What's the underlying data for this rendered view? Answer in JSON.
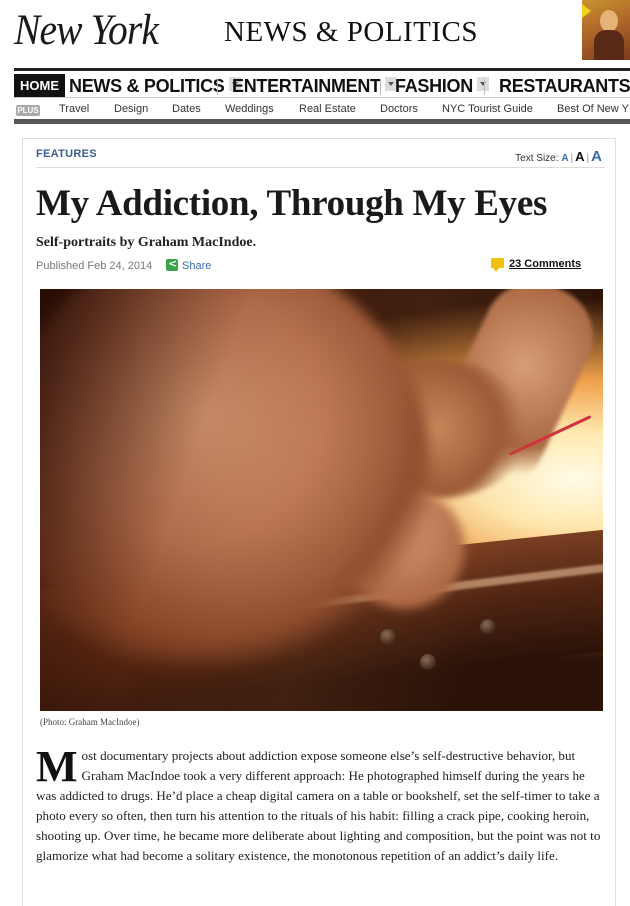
{
  "masthead": {
    "logo": "New York",
    "section": "NEWS & POLITICS"
  },
  "nav": {
    "home": "HOME",
    "items": [
      {
        "label": "NEWS & POLITICS"
      },
      {
        "label": "ENTERTAINMENT"
      },
      {
        "label": "FASHION"
      },
      {
        "label": "RESTAURANTS"
      }
    ]
  },
  "subnav": {
    "plus": "PLUS",
    "items": [
      "Travel",
      "Design",
      "Dates",
      "Weddings",
      "Real Estate",
      "Doctors",
      "NYC Tourist Guide",
      "Best Of New Y"
    ]
  },
  "article": {
    "section": "FEATURES",
    "text_size_label": "Text Size:",
    "text_size_options": [
      "A",
      "A",
      "A"
    ],
    "headline": "My Addiction, Through My Eyes",
    "dek": "Self-portraits by Graham MacIndoe.",
    "published": "Published Feb 24, 2014",
    "share": "Share",
    "comments": "23 Comments",
    "caption": "(Photo: Graham MacIndoe)",
    "dropcap": "M",
    "body": "ost documentary projects about addiction expose someone else’s self-destructive behavior, but Graham MacIndoe took a very different approach: He photographed himself during the years he was addicted to drugs. He’d place a cheap digital camera on a table or bookshelf, set the self-timer to take a photo every so often, then turn his attention to the rituals of his habit: filling a crack pipe, cooking heroin, shooting up. Over time, he became more deliberate about lighting and composition, but the point was not to glamorize what had become a solitary existence, the monotonous repetition of an addict’s daily life."
  },
  "colors": {
    "link": "#3b6aa8",
    "features": "#3b5d8a",
    "share_icon": "#3aa34b",
    "comment_icon": "#f0c20f",
    "nav_home_bg": "#111111"
  }
}
